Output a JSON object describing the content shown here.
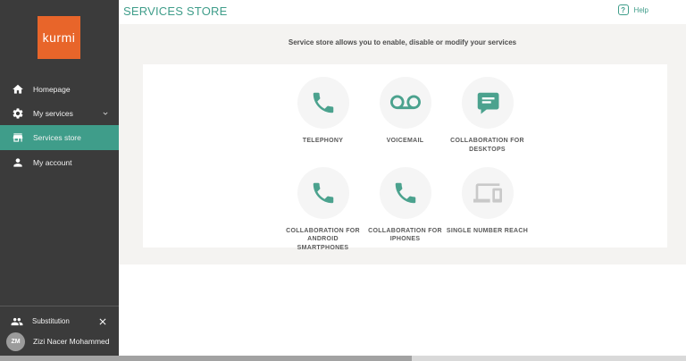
{
  "brand": {
    "logo_text": "kurmi"
  },
  "header": {
    "title": "SERVICES STORE",
    "help_label": "Help",
    "help_symbol": "?"
  },
  "sidebar": {
    "items": [
      {
        "label": "Homepage",
        "icon": "home-icon",
        "active": false
      },
      {
        "label": "My services",
        "icon": "gear-icon",
        "active": false,
        "expandable": true
      },
      {
        "label": "Services store",
        "icon": "store-icon",
        "active": true
      },
      {
        "label": "My account",
        "icon": "person-icon",
        "active": false
      }
    ],
    "substitution_label": "Substitution",
    "user": {
      "initials": "ZM",
      "name": "Zizi Nacer Mohammed"
    }
  },
  "main": {
    "subtitle": "Service store allows you to enable, disable or modify your services",
    "services": [
      {
        "label": "TELEPHONY",
        "icon": "phone-icon",
        "state": "enabled"
      },
      {
        "label": "VOICEMAIL",
        "icon": "voicemail-icon",
        "state": "enabled"
      },
      {
        "label": "COLLABORATION FOR DESKTOPS",
        "icon": "chat-icon",
        "state": "enabled"
      },
      {
        "label": "COLLABORATION FOR ANDROID SMARTPHONES",
        "icon": "phone-icon",
        "state": "enabled"
      },
      {
        "label": "COLLABORATION FOR IPHONES",
        "icon": "phone-icon",
        "state": "enabled"
      },
      {
        "label": "SINGLE NUMBER REACH",
        "icon": "devices-icon",
        "state": "disabled"
      }
    ]
  },
  "colors": {
    "accent": "#3F9D8A",
    "sidebar_bg": "#3B3B3B",
    "logo_orange": "#E8652A",
    "disabled_icon": "#C9C9C9",
    "content_bg": "#F4F3F1"
  }
}
